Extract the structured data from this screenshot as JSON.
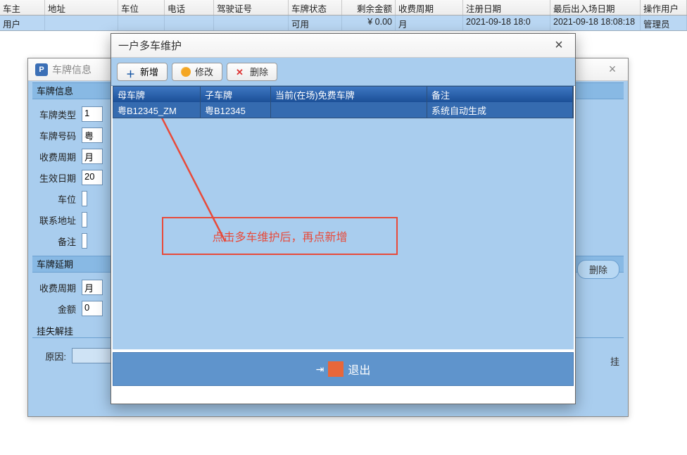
{
  "grid": {
    "headers": {
      "owner": "车主",
      "address": "地址",
      "space": "车位",
      "phone": "电话",
      "license": "驾驶证号",
      "plate_state": "车牌状态",
      "balance": "剩余金额",
      "cycle": "收费周期",
      "reg": "注册日期",
      "last": "最后出入场日期",
      "opuser": "操作用户"
    },
    "row": {
      "owner": "用户",
      "address": "",
      "space": "",
      "phone": "",
      "license": "",
      "plate_state": "可用",
      "balance": "¥ 0.00",
      "cycle": "月",
      "reg": "2021-09-18 18:0",
      "last": "2021-09-18 18:08:18",
      "opuser": "管理员"
    }
  },
  "back_dialog": {
    "icon_text": "P",
    "title": "车牌信息",
    "close": "×",
    "section_info": "车牌信息",
    "form": {
      "plate_type": {
        "label": "车牌类型",
        "value": "1"
      },
      "plate_no": {
        "label": "车牌号码",
        "value": "粤"
      },
      "pay_cycle": {
        "label": "收费周期",
        "value": "月"
      },
      "effective": {
        "label": "生效日期",
        "value": "20"
      },
      "space": {
        "label": "车位",
        "value": ""
      },
      "address": {
        "label": "联系地址",
        "value": ""
      },
      "remark": {
        "label": "备注",
        "value": ""
      }
    },
    "section_delay": "车牌延期",
    "form2": {
      "pay_cycle": {
        "label": "收费周期",
        "value": "月"
      },
      "amount": {
        "label": "金额",
        "value": "0"
      }
    },
    "section_lost": "挂失解挂",
    "reason": {
      "label": "原因:",
      "value": ""
    },
    "delete_pill": "删除",
    "gua": "挂"
  },
  "front_dialog": {
    "title": "一户多车维护",
    "close": "×",
    "toolbar": {
      "add": "新增",
      "edit": "修改",
      "delete": "删除"
    },
    "table": {
      "headers": {
        "mother": "母车牌",
        "child": "子车牌",
        "current": "当前(在场)免费车牌",
        "remark": "备注"
      },
      "row": {
        "mother": "粤B12345_ZM",
        "child": "粤B12345",
        "current": "",
        "remark": "系统自动生成"
      }
    },
    "annotation": "点击多车维护后，再点新增",
    "exit": "退出"
  }
}
